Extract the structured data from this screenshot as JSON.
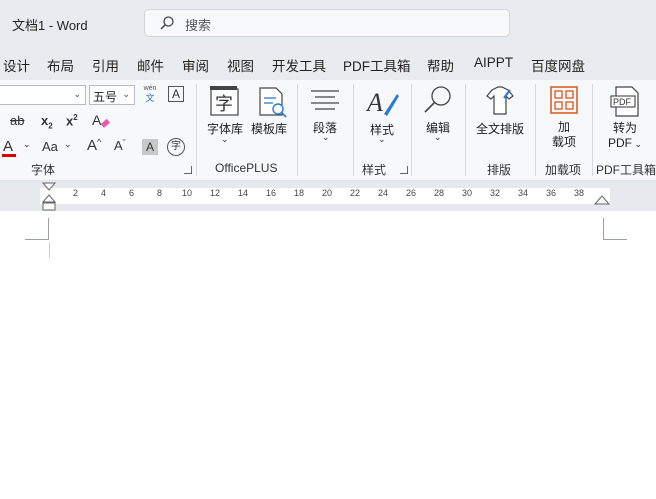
{
  "titlebar": {
    "title": "文档1  -  Word",
    "search_placeholder": "搜索"
  },
  "menu": [
    "设计",
    "布局",
    "引用",
    "邮件",
    "审阅",
    "视图",
    "开发工具",
    "PDF工具箱",
    "帮助",
    "AIPPT",
    "百度网盘"
  ],
  "font_group": {
    "font_size": "五号",
    "phonetic_top": "wén",
    "phonetic_bottom": "文",
    "border_char": "A",
    "strike": "ab",
    "subscript": "x",
    "subscript_mark": "2",
    "superscript": "x",
    "superscript_mark": "2",
    "font_color": "A",
    "case_label": "Aa",
    "grow": "A",
    "shrink": "A",
    "shade": "A",
    "enclose": "字",
    "label": "字体"
  },
  "officeplus": {
    "font_lib": "字体库",
    "template_lib": "模板库",
    "label": "OfficePLUS"
  },
  "paragraph": {
    "label": "段落"
  },
  "styles": {
    "style_btn": "样式",
    "label": "样式"
  },
  "editing": {
    "label": "编辑"
  },
  "layout": {
    "full_text": "全文排版",
    "label": "排版"
  },
  "addins": {
    "line1": "加",
    "line2": "载项",
    "label": "加载项"
  },
  "pdf": {
    "line1": "转为",
    "line2": "PDF",
    "label": "PDF工具箱"
  },
  "ruler_ticks": [
    "2",
    "4",
    "6",
    "8",
    "10",
    "12",
    "14",
    "16",
    "18",
    "20",
    "22",
    "24",
    "26",
    "28",
    "30",
    "32",
    "34",
    "36",
    "38"
  ],
  "colors": {
    "chrome": "#e8ecf0",
    "ribbon": "#f7f8fa",
    "font_color_red": "#d40000",
    "addin_orange": "#d9622b"
  }
}
